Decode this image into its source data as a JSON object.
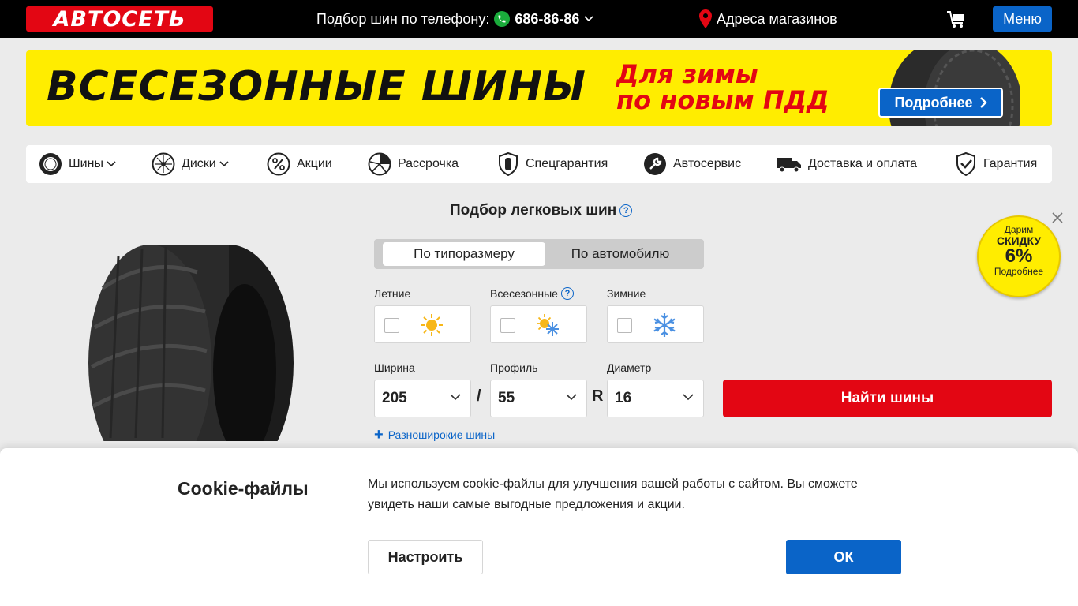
{
  "header": {
    "logo_text": "АВТОСЕТЬ",
    "phone_label": "Подбор шин по телефону:",
    "phone_number": "686-86-86",
    "stores_label": "Адреса магазинов",
    "menu_label": "Меню"
  },
  "banner": {
    "title": "ВСЕСЕЗОННЫЕ ШИНЫ",
    "subtitle_line1": "Для зимы",
    "subtitle_line2": "по новым ПДД",
    "button_label": "Подробнее"
  },
  "nav": {
    "items": [
      {
        "label": "Шины",
        "icon": "tire-icon"
      },
      {
        "label": "Диски",
        "icon": "wheel-rim-icon"
      },
      {
        "label": "Акции",
        "icon": "percent-icon"
      },
      {
        "label": "Рассрочка",
        "icon": "pie-chart-icon"
      },
      {
        "label": "Спецгарантия",
        "icon": "shield-tire-icon"
      },
      {
        "label": "Автосервис",
        "icon": "wrench-icon"
      },
      {
        "label": "Доставка и оплата",
        "icon": "truck-icon"
      },
      {
        "label": "Гарантия",
        "icon": "shield-check-icon"
      }
    ]
  },
  "selector": {
    "title": "Подбор легковых шин",
    "tabs": [
      "По типоразмеру",
      "По автомобилю"
    ],
    "active_tab": "По типоразмеру",
    "seasons": [
      {
        "label": "Летние",
        "icon": "sun-icon",
        "checked": false
      },
      {
        "label": "Всесезонные",
        "icon": "sun-snow-icon",
        "checked": false
      },
      {
        "label": "Зимние",
        "icon": "snowflake-icon",
        "checked": false
      }
    ],
    "width_label": "Ширина",
    "width_value": "205",
    "profile_label": "Профиль",
    "profile_value": "55",
    "diameter_label": "Диаметр",
    "diameter_value": "16",
    "separator_slash": "/",
    "separator_r": "R",
    "find_button": "Найти шины",
    "wide_tires_link": "Разноширокие шины"
  },
  "promo": {
    "line1": "Дарим",
    "line2": "СКИДКУ",
    "line3": "6%",
    "line4": "Подробнее"
  },
  "cookie": {
    "title": "Cookie-файлы",
    "text": "Мы используем cookie-файлы для улучшения вашей работы с сайтом. Вы сможете увидеть наши самые выгодные предложения и акции.",
    "settings_button": "Настроить",
    "ok_button": "ОК"
  },
  "colors": {
    "brand_red": "#e30613",
    "brand_blue": "#0a64c8",
    "banner_yellow": "#ffed00",
    "header_black": "#000000"
  }
}
